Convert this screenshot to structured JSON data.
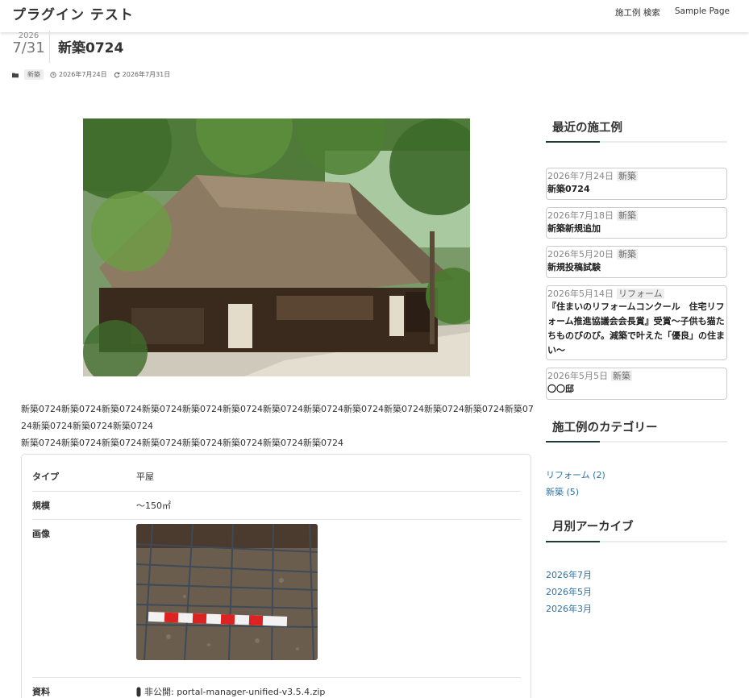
{
  "site": {
    "title": "プラグイン テスト"
  },
  "nav": {
    "items": [
      "施工例 検索",
      "Sample Page"
    ]
  },
  "post": {
    "year": "2026",
    "month_day": "7/31",
    "title": "新築0724",
    "category": "新築",
    "published": "2026年7月24日",
    "updated": "2026年7月31日",
    "body_line1": "新築0724新築0724新築0724新築0724新築0724新築0724新築0724新築0724新築0724新築0724新築0724新築0724新築0724新築0724新築0724新築0724",
    "body_line2": "新築0724新築0724新築0724新築0724新築0724新築0724新築0724新築0724"
  },
  "details": {
    "type_label": "タイプ",
    "type_value": "平屋",
    "scale_label": "規模",
    "scale_value": "〜150㎡",
    "image_label": "画像",
    "doc_label": "資料",
    "doc_value": "非公開: portal-manager-unified-v3.5.4.zip"
  },
  "sidebar": {
    "recent_title": "最近の施工例",
    "recent": [
      {
        "date": "2026年7月24日",
        "cat": "新築",
        "title": "新築0724"
      },
      {
        "date": "2026年7月18日",
        "cat": "新築",
        "title": "新築新規追加"
      },
      {
        "date": "2026年5月20日",
        "cat": "新築",
        "title": "新規投稿試験"
      },
      {
        "date": "2026年5月14日",
        "cat": "リフォーム",
        "title": "『住まいのリフォームコンクール　住宅リフォーム推進協議会会長賞』受賞〜子供も猫たちものびのび。減築で叶えた「優良」の住まい〜"
      },
      {
        "date": "2026年5月5日",
        "cat": "新築",
        "title": "〇〇邸"
      }
    ],
    "categories_title": "施工例のカテゴリー",
    "categories": [
      "リフォーム (2)",
      "新築 (5)"
    ],
    "archive_title": "月別アーカイブ",
    "archives": [
      "2026年7月",
      "2026年5月",
      "2026年3月"
    ]
  },
  "colors": {
    "accent": "#1f3a3c",
    "link": "#2a73a8"
  }
}
